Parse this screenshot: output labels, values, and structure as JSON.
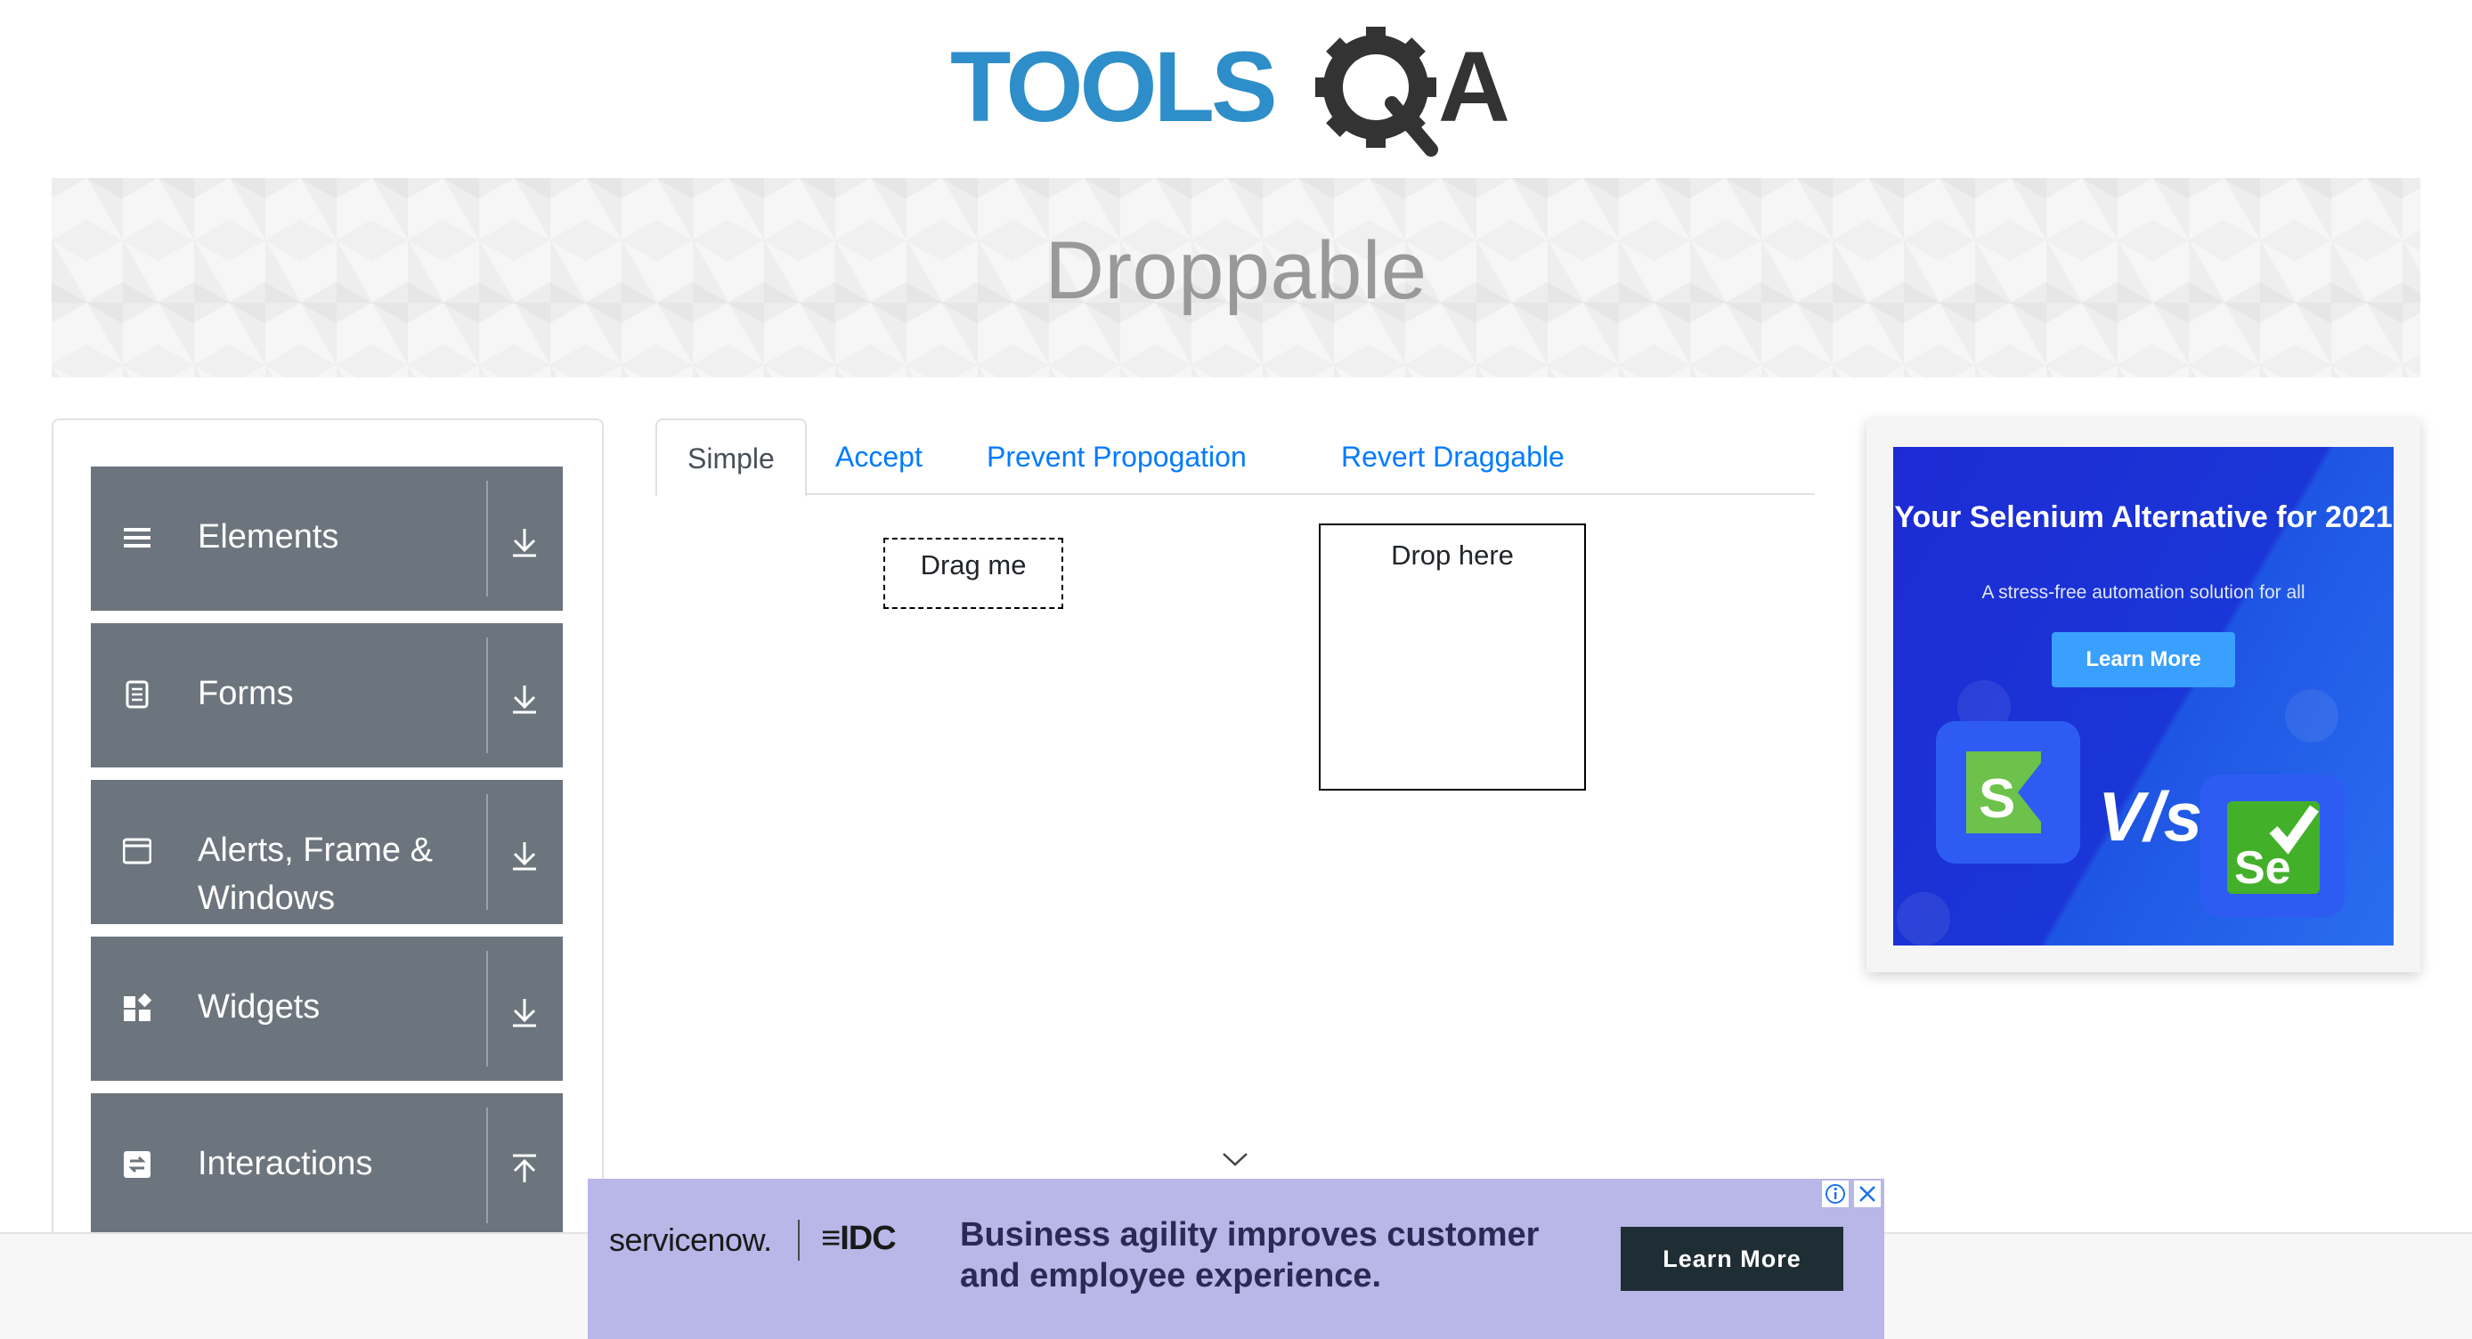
{
  "header": {
    "logo_tools": "TOOLS",
    "logo_qa": "QA"
  },
  "banner": {
    "title": "Droppable"
  },
  "sidebar": {
    "groups": [
      {
        "label": "Elements",
        "icon": "hamburger-icon",
        "toggle": "download-arrow-icon"
      },
      {
        "label": "Forms",
        "icon": "document-icon",
        "toggle": "download-arrow-icon"
      },
      {
        "label": "Alerts, Frame & Windows",
        "icon": "window-icon",
        "toggle": "download-arrow-icon"
      },
      {
        "label": "Widgets",
        "icon": "widgets-icon",
        "toggle": "download-arrow-icon"
      },
      {
        "label": "Interactions",
        "icon": "interactions-icon",
        "toggle": "upload-arrow-icon"
      }
    ]
  },
  "tabs": [
    {
      "label": "Simple",
      "active": true
    },
    {
      "label": "Accept",
      "active": false
    },
    {
      "label": "Prevent Propogation",
      "active": false
    },
    {
      "label": "Revert Draggable",
      "active": false
    }
  ],
  "simple": {
    "draggable_label": "Drag me",
    "droppable_label": "Drop here"
  },
  "right_ad": {
    "headline": "Your Selenium Alternative for 2021",
    "subtext": "A stress-free automation solution for all",
    "cta": "Learn More",
    "vs": "V/s",
    "left_logo": "S",
    "right_logo": "Se"
  },
  "bottom_ad": {
    "brand": "servicenow.",
    "partner": "IDC",
    "copy": "Business agility improves customer and employee experience.",
    "cta": "Learn More"
  },
  "colors": {
    "accent": "#007bff",
    "sidebar_group": "#6c757d",
    "logo_blue": "#2e8ec9",
    "logo_dark": "#333333",
    "ad_blue": "#1d2bd4",
    "bottom_ad_bg": "#b9b6e8"
  }
}
